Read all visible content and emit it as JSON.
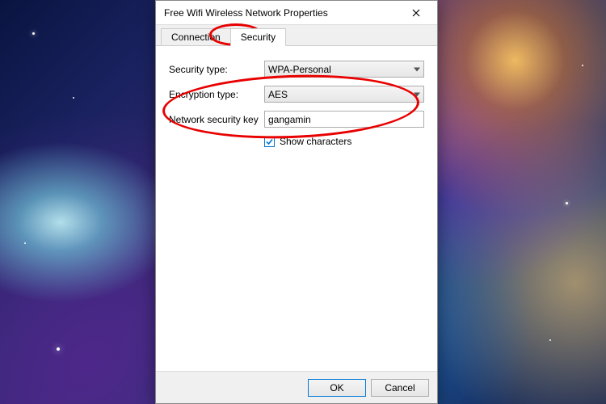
{
  "dialog": {
    "title": "Free Wifi Wireless Network Properties"
  },
  "tabs": {
    "connection": "Connection",
    "security": "Security"
  },
  "fields": {
    "security_type_label": "Security type:",
    "security_type_value": "WPA-Personal",
    "encryption_type_label": "Encryption type:",
    "encryption_type_value": "AES",
    "network_key_label": "Network security key",
    "network_key_value": "gangamin",
    "show_characters_label": "Show characters"
  },
  "buttons": {
    "ok": "OK",
    "cancel": "Cancel"
  }
}
